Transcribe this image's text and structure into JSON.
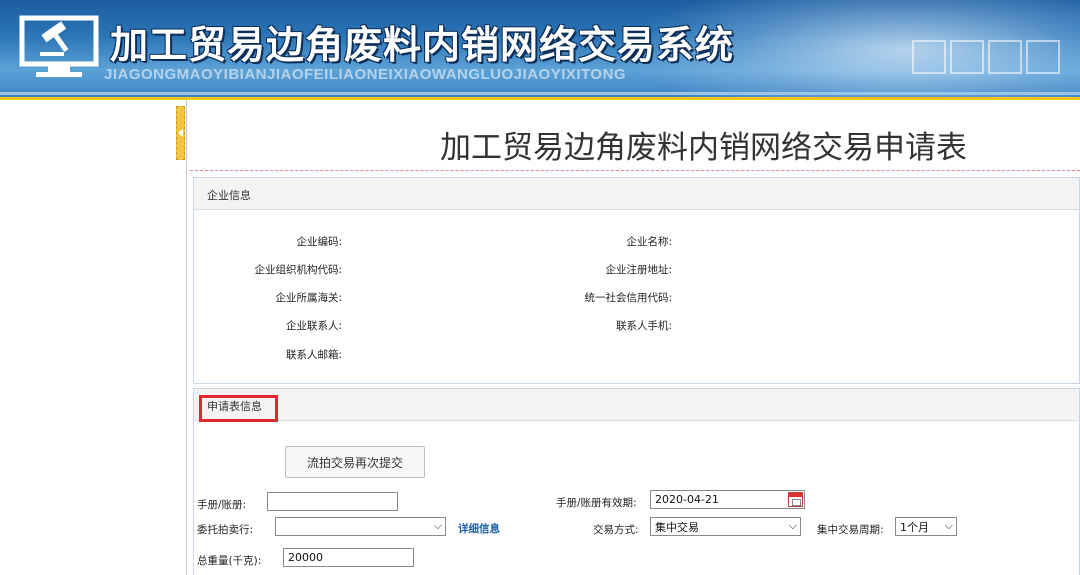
{
  "header": {
    "title": "加工贸易边角废料内销网络交易系统",
    "pinyin": "JIAGONGMAOYIBIANJIAOFEILIAONEIXIAOWANGLUOJIAOYIXITONG",
    "accent_color": "#f0c419"
  },
  "form": {
    "title": "加工贸易边角废料内销网络交易申请表"
  },
  "enterprise_section": {
    "heading": "企业信息",
    "fields": {
      "code_label": "企业编码:",
      "name_label": "企业名称:",
      "org_code_label": "企业组织机构代码:",
      "address_label": "企业注册地址:",
      "customs_label": "企业所属海关:",
      "credit_code_label": "统一社会信用代码:",
      "contact_label": "企业联系人:",
      "mobile_label": "联系人手机:",
      "email_label": "联系人邮箱:"
    }
  },
  "application_section": {
    "heading": "申请表信息",
    "resubmit_button": "流拍交易再次提交",
    "manual_label": "手册/账册:",
    "manual_value": "",
    "validity_label": "手册/账册有效期:",
    "validity_value": "2020-04-21",
    "auction_label": "委托拍卖行:",
    "auction_value": "",
    "detail_link": "详细信息",
    "trade_mode_label": "交易方式:",
    "trade_mode_value": "集中交易",
    "period_label": "集中交易周期:",
    "period_value": "1个月",
    "weight_label": "总重量(千克):",
    "weight_value": "20000"
  },
  "icons": {
    "logo": "computer-gavel-icon",
    "collapse": "collapse-arrow-icon",
    "calendar": "calendar-icon",
    "dropdown": "chevron-down-icon"
  }
}
